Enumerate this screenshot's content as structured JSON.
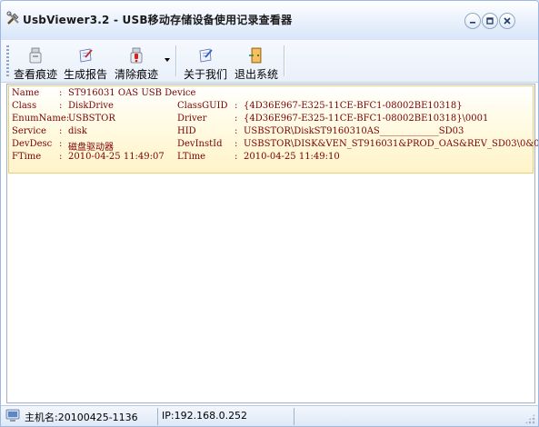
{
  "window": {
    "title": "UsbViewer3.2 - USB移动存储设备使用记录查看器"
  },
  "toolbar": {
    "view_traces": "查看痕迹",
    "generate_report": "生成报告",
    "clear_traces": "清除痕迹",
    "about": "关于我们",
    "exit": "退出系统"
  },
  "record": {
    "name_key": "Name",
    "name": "ST916031 OAS USB Device",
    "class_key": "Class",
    "class": "DiskDrive",
    "classguid_key": "ClassGUID",
    "classguid": "{4D36E967-E325-11CE-BFC1-08002BE10318}",
    "enumname_key": "EnumName:",
    "enumname": "USBSTOR",
    "driver_key": "Driver",
    "driver": "{4D36E967-E325-11CE-BFC1-08002BE10318}\\0001",
    "service_key": "Service",
    "service": "disk",
    "hid_key": "HID",
    "hid": "USBSTOR\\DiskST9160310AS_____________SD03",
    "devdesc_key": "DevDesc",
    "devdesc": "磁盘驱动器",
    "devinstid_key": "DevInstId",
    "devinstid": "USBSTOR\\DISK&VEN_ST916031&PROD_OAS&REV_SD03\\0&0",
    "ftime_key": "FTime",
    "ftime": "2010-04-25 11:49:07",
    "ltime_key": "LTime",
    "ltime": "2010-04-25 11:49:10",
    "colon": ":"
  },
  "status": {
    "hostname": "主机名:20100425-1136",
    "ip": "IP:192.168.0.252"
  },
  "colors": {
    "record_text": "#7a0000",
    "record_bg": "#fff3c8",
    "titlebar": "#d7e5f8"
  },
  "icons": {
    "app": "tools-icon",
    "view": "usb-drive-icon",
    "report": "report-icon",
    "clear": "usb-clear-icon",
    "about": "about-icon",
    "exit": "exit-door-icon",
    "status": "computer-icon"
  }
}
